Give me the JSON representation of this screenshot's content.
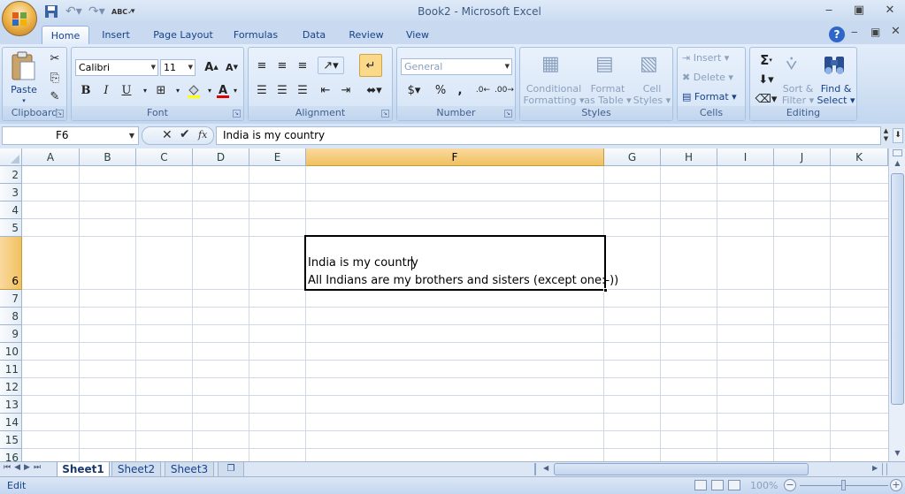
{
  "window": {
    "title": "Book2 - Microsoft Excel"
  },
  "tabs": [
    "Home",
    "Insert",
    "Page Layout",
    "Formulas",
    "Data",
    "Review",
    "View"
  ],
  "active_tab": "Home",
  "ribbon": {
    "clipboard": {
      "label": "Clipboard",
      "paste": "Paste"
    },
    "font": {
      "label": "Font",
      "name": "Calibri",
      "size": "11",
      "bold": "B",
      "italic": "I",
      "underline": "U"
    },
    "alignment": {
      "label": "Alignment"
    },
    "number": {
      "label": "Number",
      "format": "General",
      "percent": "%",
      "comma": ","
    },
    "styles": {
      "label": "Styles",
      "conditional_formatting": "Conditional Formatting",
      "conditional_l1": "Conditional",
      "conditional_l2": "Formatting",
      "format_table_l1": "Format",
      "format_table_l2": "as Table",
      "cell_styles_l1": "Cell",
      "cell_styles_l2": "Styles"
    },
    "cells": {
      "label": "Cells",
      "insert": "Insert",
      "delete": "Delete",
      "format": "Format"
    },
    "editing": {
      "label": "Editing",
      "sort_l1": "Sort &",
      "sort_l2": "Filter",
      "find_l1": "Find &",
      "find_l2": "Select",
      "sigma": "Σ"
    }
  },
  "formula_bar": {
    "name_box": "F6",
    "fx": "fx",
    "content": "India is my country"
  },
  "grid": {
    "columns": [
      "A",
      "B",
      "C",
      "D",
      "E",
      "F",
      "G",
      "H",
      "I",
      "J",
      "K"
    ],
    "rows": [
      "2",
      "3",
      "4",
      "5",
      "6",
      "7",
      "8",
      "9",
      "10",
      "11",
      "12",
      "13",
      "14",
      "15",
      "16"
    ],
    "selected_column": "F",
    "selected_row": "6",
    "active_cell": {
      "line1": "India is my country",
      "line2": "All Indians are my brothers and sisters (except one:-))"
    }
  },
  "sheets": [
    "Sheet1",
    "Sheet2",
    "Sheet3"
  ],
  "active_sheet": "Sheet1",
  "status": {
    "mode": "Edit",
    "zoom": "100%"
  }
}
